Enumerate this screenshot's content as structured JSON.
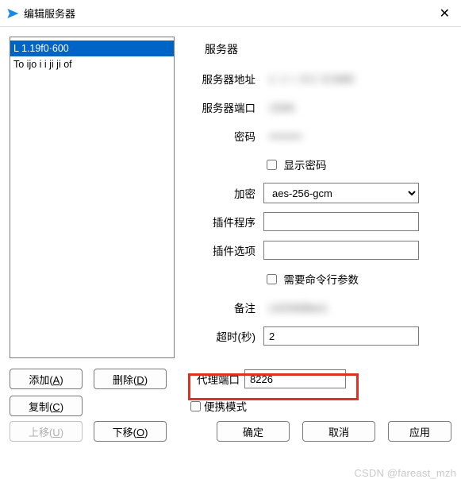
{
  "window": {
    "title": "编辑服务器"
  },
  "list": {
    "items": [
      {
        "text": "L                                  1.19f0·600",
        "selected": true
      },
      {
        "text": "To ijo i  i  ji               ji           of",
        "selected": false
      }
    ]
  },
  "group": {
    "title": "服务器"
  },
  "form": {
    "server_addr": {
      "label": "服务器地址",
      "value": "1  i i  i  8 2 -5.5480"
    },
    "server_port": {
      "label": "服务器端口",
      "value": "1334i"
    },
    "password": {
      "label": "密码",
      "value": "•••••••••"
    },
    "show_pw": {
      "label": "显示密码",
      "checked": false
    },
    "encrypt": {
      "label": "加密",
      "value": "aes-256-gcm"
    },
    "plugin": {
      "label": "插件程序",
      "value": ""
    },
    "plugin_opt": {
      "label": "插件选项",
      "value": ""
    },
    "need_cli": {
      "label": "需要命令行参数",
      "checked": false
    },
    "remark": {
      "label": "备注",
      "value": "LA234(libev)"
    },
    "timeout": {
      "label": "超时(秒)",
      "value": "2"
    }
  },
  "proxy": {
    "label": "代理端口",
    "value": "8226"
  },
  "portable": {
    "label": "便携模式",
    "checked": false
  },
  "buttons": {
    "add": "添加(A)",
    "del": "删除(D)",
    "copy": "复制(C)",
    "up": "上移(U)",
    "down": "下移(O)",
    "ok": "确定",
    "cancel": "取消",
    "apply": "应用"
  },
  "watermark": "CSDN @fareast_mzh"
}
